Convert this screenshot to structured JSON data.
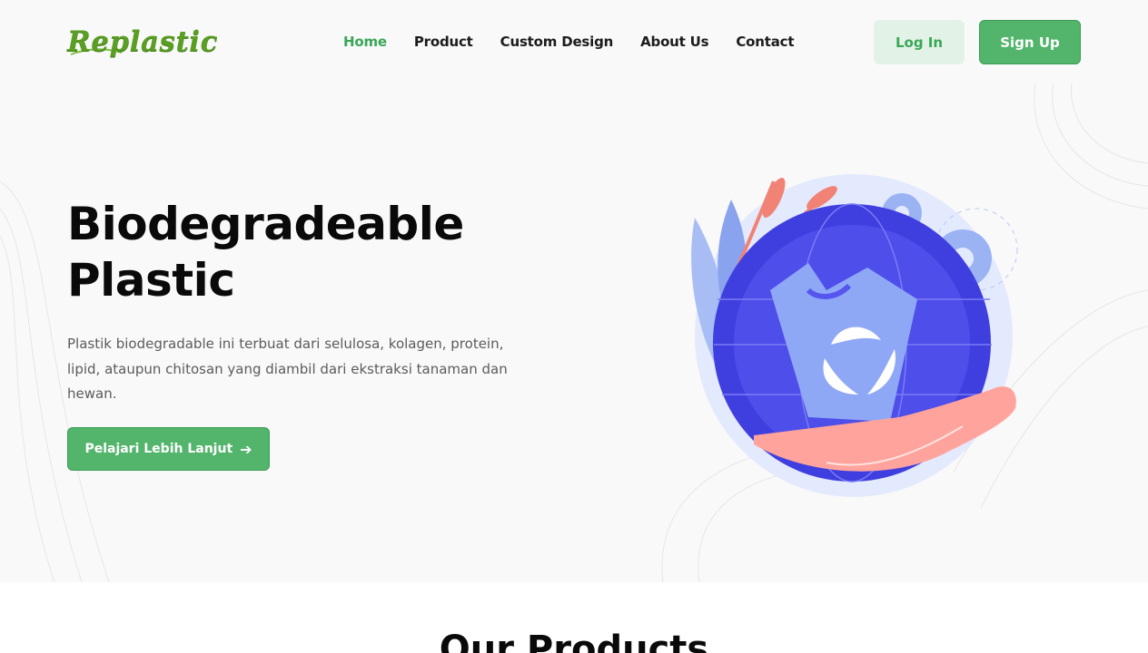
{
  "brand": {
    "logo_text": "Replastic",
    "accent": "#52b56b"
  },
  "nav": {
    "items": [
      {
        "label": "Home",
        "active": true
      },
      {
        "label": "Product",
        "active": false
      },
      {
        "label": "Custom Design",
        "active": false
      },
      {
        "label": "About Us",
        "active": false
      },
      {
        "label": "Contact",
        "active": false
      }
    ]
  },
  "auth": {
    "login_label": "Log In",
    "signup_label": "Sign Up"
  },
  "hero": {
    "title_line1": "Biodegradeable",
    "title_line2": "Plastic",
    "description": "Plastik biodegradable ini terbuat dari selulosa, kolagen, protein, lipid, ataupun chitosan yang diambil dari ekstraksi tanaman dan hewan.",
    "cta_label": "Pelajari Lebih Lanjut",
    "cta_icon": "arrow-right-icon"
  },
  "products": {
    "title": "Our Products"
  }
}
